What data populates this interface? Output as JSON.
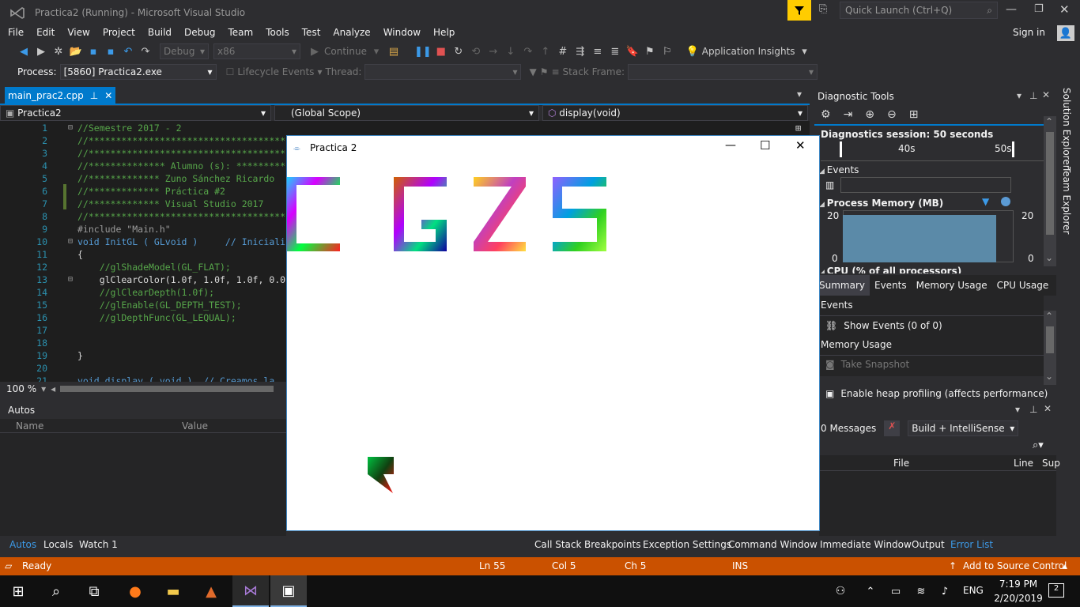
{
  "window": {
    "title": "Practica2 (Running) - Microsoft Visual Studio",
    "quick_launch": "Quick Launch (Ctrl+Q)",
    "sign_in": "Sign in"
  },
  "menu": [
    "File",
    "Edit",
    "View",
    "Project",
    "Build",
    "Debug",
    "Team",
    "Tools",
    "Test",
    "Analyze",
    "Window",
    "Help"
  ],
  "toolbar": {
    "config": "Debug",
    "platform": "x86",
    "continue": "Continue",
    "app_insights": "Application Insights"
  },
  "toolbar2": {
    "process_label": "Process:",
    "process_value": "[5860] Practica2.exe",
    "lifecycle": "Lifecycle Events",
    "thread_label": "Thread:",
    "stack_frame_label": "Stack Frame:"
  },
  "doc_tab": {
    "name": "main_prac2.cpp"
  },
  "navbar": {
    "project": "Practica2",
    "scope": "(Global Scope)",
    "member": "display(void)"
  },
  "editor": {
    "zoom": "100 %",
    "line_numbers": [
      "1",
      "2",
      "3",
      "4",
      "5",
      "6",
      "7",
      "8",
      "9",
      "10",
      "11",
      "12",
      "13",
      "14",
      "15",
      "16",
      "17",
      "18",
      "19",
      "20",
      "21"
    ],
    "lines": [
      "//Semestre 2017 - 2",
      "//************************************",
      "//************************************",
      "//************** Alumno (s): *********",
      "//************* Zuno Sánchez Ricardo",
      "//************* Práctica #2",
      "//************* Visual Studio 2017",
      "//************************************",
      "#include \"Main.h\"",
      "void InitGL ( GLvoid )     // Iniciali",
      "{",
      "    //glShadeModel(GL_FLAT);",
      "    glClearColor(1.0f, 1.0f, 1.0f, 0.0",
      "    //glClearDepth(1.0f);",
      "    //glEnable(GL_DEPTH_TEST);",
      "    //glDepthFunc(GL_LEQUAL);",
      "",
      "",
      "}",
      "",
      "void display ( void )  // Creamos la"
    ]
  },
  "app_window": {
    "title": "Practica 2"
  },
  "diagnostics": {
    "title": "Diagnostic Tools",
    "session": "Diagnostics session: 50 seconds",
    "tick_40": "40s",
    "tick_50": "50s",
    "events": "Events",
    "process_memory": "Process Memory (MB)",
    "mem_max_left": "20",
    "mem_min_left": "0",
    "mem_max_right": "20",
    "mem_min_right": "0",
    "cpu": "CPU (% of all processors)",
    "tabs": [
      "Summary",
      "Events",
      "Memory Usage",
      "CPU Usage"
    ],
    "events_header": "Events",
    "show_events": "Show Events (0 of 0)",
    "memory_usage_header": "Memory Usage",
    "take_snapshot": "Take Snapshot",
    "heap_profiling": "Enable heap profiling (affects performance)"
  },
  "autos": {
    "title": "Autos",
    "col_name": "Name",
    "col_value": "Value"
  },
  "error_list": {
    "messages": "0 Messages",
    "filter": "Build + IntelliSense",
    "col_file": "File",
    "col_line": "Line",
    "col_sup": "Sup"
  },
  "bottom_tabs_left": [
    "Autos",
    "Locals",
    "Watch 1"
  ],
  "bottom_tabs_right": [
    "Call Stack",
    "Breakpoints",
    "Exception Settings",
    "Command Window",
    "Immediate Window",
    "Output",
    "Error List"
  ],
  "status": {
    "ready": "Ready",
    "ln": "Ln 55",
    "col": "Col 5",
    "ch": "Ch 5",
    "ins": "INS",
    "source_control": "Add to Source Control"
  },
  "taskbar": {
    "lang": "ENG",
    "time": "7:19 PM",
    "date": "2/20/2019",
    "notif": "2"
  },
  "colors": {
    "accent": "#007acc",
    "status_bar": "#ca5100",
    "memory_fill": "#5b8aa8"
  }
}
